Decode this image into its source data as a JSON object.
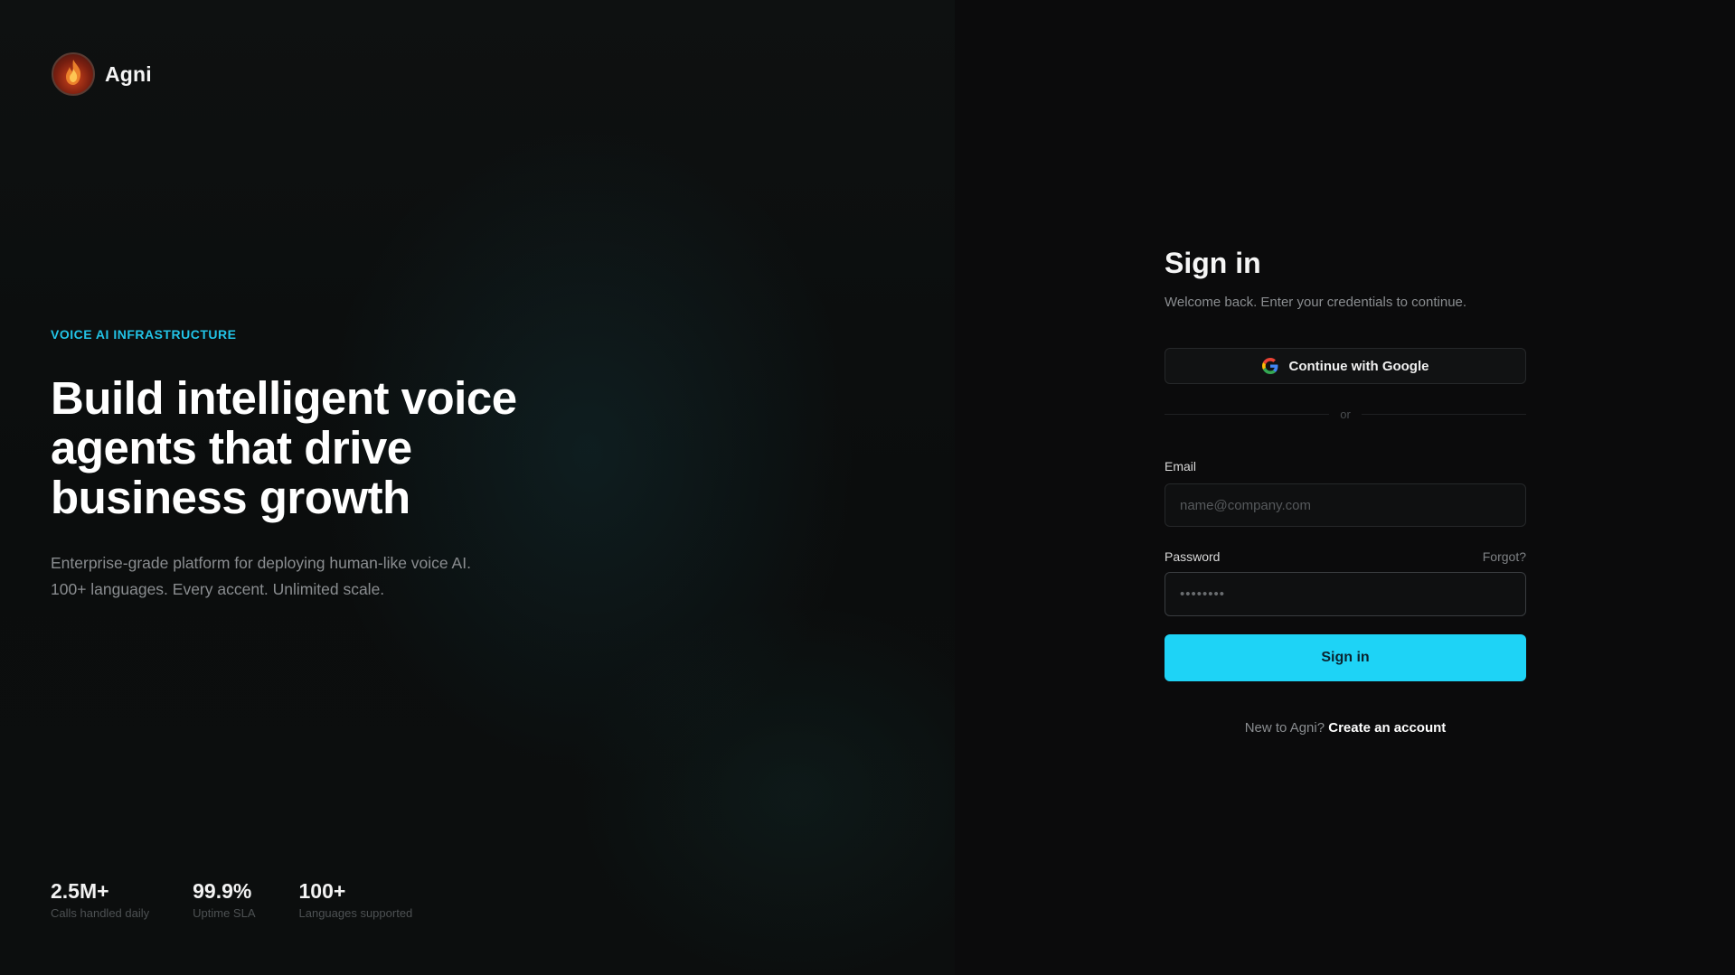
{
  "brand": {
    "name": "Agni",
    "logo_text": "AGNI"
  },
  "hero": {
    "eyebrow": "VOICE AI INFRASTRUCTURE",
    "headline_line1": "Build intelligent voice",
    "headline_line2": "agents that drive",
    "headline_line3": "business growth",
    "sub_line1": "Enterprise-grade platform for deploying human-like voice AI.",
    "sub_line2": "100+ languages. Every accent. Unlimited scale."
  },
  "stats": [
    {
      "value": "2.5M+",
      "label": "Calls handled daily"
    },
    {
      "value": "99.9%",
      "label": "Uptime SLA"
    },
    {
      "value": "100+",
      "label": "Languages supported"
    }
  ],
  "signin": {
    "title": "Sign in",
    "welcome": "Welcome back. Enter your credentials to continue.",
    "google_label": "Continue with Google",
    "divider_text": "or",
    "email_label": "Email",
    "email_placeholder": "name@company.com",
    "password_label": "Password",
    "password_placeholder": "••••••••",
    "forgot_label": "Forgot?",
    "submit_label": "Sign in",
    "footer_text": "New to Agni?",
    "footer_link": "Create an account"
  },
  "colors": {
    "accent": "#1ed3f6",
    "eyebrow": "#22c3e6",
    "background": "#0b0b0c"
  }
}
